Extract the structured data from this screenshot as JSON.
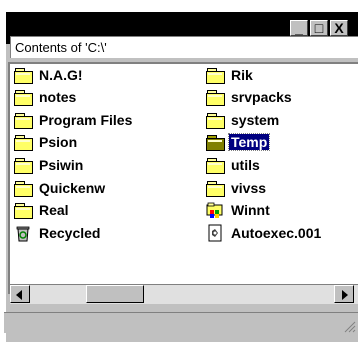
{
  "window": {
    "caption_buttons": {
      "minimize": "_",
      "maximize": "□",
      "close": "X"
    }
  },
  "header": {
    "label": "Contents of 'C:\\'"
  },
  "files": {
    "left": [
      {
        "name": "N.A.G!",
        "icon": "folder-icon"
      },
      {
        "name": "notes",
        "icon": "folder-icon"
      },
      {
        "name": "Program Files",
        "icon": "folder-icon"
      },
      {
        "name": "Psion",
        "icon": "folder-icon"
      },
      {
        "name": "Psiwin",
        "icon": "folder-icon"
      },
      {
        "name": "Quickenw",
        "icon": "folder-icon"
      },
      {
        "name": "Real",
        "icon": "folder-icon"
      },
      {
        "name": "Recycled",
        "icon": "recycle-bin-icon"
      }
    ],
    "right": [
      {
        "name": "Rik",
        "icon": "folder-icon"
      },
      {
        "name": "srvpacks",
        "icon": "folder-icon"
      },
      {
        "name": "system",
        "icon": "folder-icon"
      },
      {
        "name": "Temp",
        "icon": "open-folder-icon",
        "selected": true
      },
      {
        "name": "utils",
        "icon": "folder-icon"
      },
      {
        "name": "vivss",
        "icon": "folder-icon"
      },
      {
        "name": "Winnt",
        "icon": "winnt-folder-icon"
      },
      {
        "name": "Autoexec.001",
        "icon": "file-icon"
      }
    ]
  },
  "colors": {
    "selection": "#000080",
    "folder": "#ffff66",
    "chrome": "#c0c0c0"
  }
}
